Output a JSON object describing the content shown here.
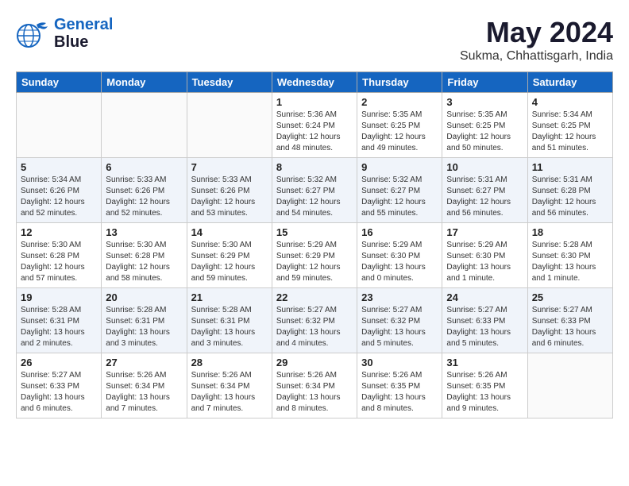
{
  "header": {
    "logo_line1": "General",
    "logo_line2": "Blue",
    "month": "May 2024",
    "location": "Sukma, Chhattisgarh, India"
  },
  "weekdays": [
    "Sunday",
    "Monday",
    "Tuesday",
    "Wednesday",
    "Thursday",
    "Friday",
    "Saturday"
  ],
  "weeks": [
    [
      {
        "day": "",
        "info": ""
      },
      {
        "day": "",
        "info": ""
      },
      {
        "day": "",
        "info": ""
      },
      {
        "day": "1",
        "info": "Sunrise: 5:36 AM\nSunset: 6:24 PM\nDaylight: 12 hours\nand 48 minutes."
      },
      {
        "day": "2",
        "info": "Sunrise: 5:35 AM\nSunset: 6:25 PM\nDaylight: 12 hours\nand 49 minutes."
      },
      {
        "day": "3",
        "info": "Sunrise: 5:35 AM\nSunset: 6:25 PM\nDaylight: 12 hours\nand 50 minutes."
      },
      {
        "day": "4",
        "info": "Sunrise: 5:34 AM\nSunset: 6:25 PM\nDaylight: 12 hours\nand 51 minutes."
      }
    ],
    [
      {
        "day": "5",
        "info": "Sunrise: 5:34 AM\nSunset: 6:26 PM\nDaylight: 12 hours\nand 52 minutes."
      },
      {
        "day": "6",
        "info": "Sunrise: 5:33 AM\nSunset: 6:26 PM\nDaylight: 12 hours\nand 52 minutes."
      },
      {
        "day": "7",
        "info": "Sunrise: 5:33 AM\nSunset: 6:26 PM\nDaylight: 12 hours\nand 53 minutes."
      },
      {
        "day": "8",
        "info": "Sunrise: 5:32 AM\nSunset: 6:27 PM\nDaylight: 12 hours\nand 54 minutes."
      },
      {
        "day": "9",
        "info": "Sunrise: 5:32 AM\nSunset: 6:27 PM\nDaylight: 12 hours\nand 55 minutes."
      },
      {
        "day": "10",
        "info": "Sunrise: 5:31 AM\nSunset: 6:27 PM\nDaylight: 12 hours\nand 56 minutes."
      },
      {
        "day": "11",
        "info": "Sunrise: 5:31 AM\nSunset: 6:28 PM\nDaylight: 12 hours\nand 56 minutes."
      }
    ],
    [
      {
        "day": "12",
        "info": "Sunrise: 5:30 AM\nSunset: 6:28 PM\nDaylight: 12 hours\nand 57 minutes."
      },
      {
        "day": "13",
        "info": "Sunrise: 5:30 AM\nSunset: 6:28 PM\nDaylight: 12 hours\nand 58 minutes."
      },
      {
        "day": "14",
        "info": "Sunrise: 5:30 AM\nSunset: 6:29 PM\nDaylight: 12 hours\nand 59 minutes."
      },
      {
        "day": "15",
        "info": "Sunrise: 5:29 AM\nSunset: 6:29 PM\nDaylight: 12 hours\nand 59 minutes."
      },
      {
        "day": "16",
        "info": "Sunrise: 5:29 AM\nSunset: 6:30 PM\nDaylight: 13 hours\nand 0 minutes."
      },
      {
        "day": "17",
        "info": "Sunrise: 5:29 AM\nSunset: 6:30 PM\nDaylight: 13 hours\nand 1 minute."
      },
      {
        "day": "18",
        "info": "Sunrise: 5:28 AM\nSunset: 6:30 PM\nDaylight: 13 hours\nand 1 minute."
      }
    ],
    [
      {
        "day": "19",
        "info": "Sunrise: 5:28 AM\nSunset: 6:31 PM\nDaylight: 13 hours\nand 2 minutes."
      },
      {
        "day": "20",
        "info": "Sunrise: 5:28 AM\nSunset: 6:31 PM\nDaylight: 13 hours\nand 3 minutes."
      },
      {
        "day": "21",
        "info": "Sunrise: 5:28 AM\nSunset: 6:31 PM\nDaylight: 13 hours\nand 3 minutes."
      },
      {
        "day": "22",
        "info": "Sunrise: 5:27 AM\nSunset: 6:32 PM\nDaylight: 13 hours\nand 4 minutes."
      },
      {
        "day": "23",
        "info": "Sunrise: 5:27 AM\nSunset: 6:32 PM\nDaylight: 13 hours\nand 5 minutes."
      },
      {
        "day": "24",
        "info": "Sunrise: 5:27 AM\nSunset: 6:33 PM\nDaylight: 13 hours\nand 5 minutes."
      },
      {
        "day": "25",
        "info": "Sunrise: 5:27 AM\nSunset: 6:33 PM\nDaylight: 13 hours\nand 6 minutes."
      }
    ],
    [
      {
        "day": "26",
        "info": "Sunrise: 5:27 AM\nSunset: 6:33 PM\nDaylight: 13 hours\nand 6 minutes."
      },
      {
        "day": "27",
        "info": "Sunrise: 5:26 AM\nSunset: 6:34 PM\nDaylight: 13 hours\nand 7 minutes."
      },
      {
        "day": "28",
        "info": "Sunrise: 5:26 AM\nSunset: 6:34 PM\nDaylight: 13 hours\nand 7 minutes."
      },
      {
        "day": "29",
        "info": "Sunrise: 5:26 AM\nSunset: 6:34 PM\nDaylight: 13 hours\nand 8 minutes."
      },
      {
        "day": "30",
        "info": "Sunrise: 5:26 AM\nSunset: 6:35 PM\nDaylight: 13 hours\nand 8 minutes."
      },
      {
        "day": "31",
        "info": "Sunrise: 5:26 AM\nSunset: 6:35 PM\nDaylight: 13 hours\nand 9 minutes."
      },
      {
        "day": "",
        "info": ""
      }
    ]
  ]
}
